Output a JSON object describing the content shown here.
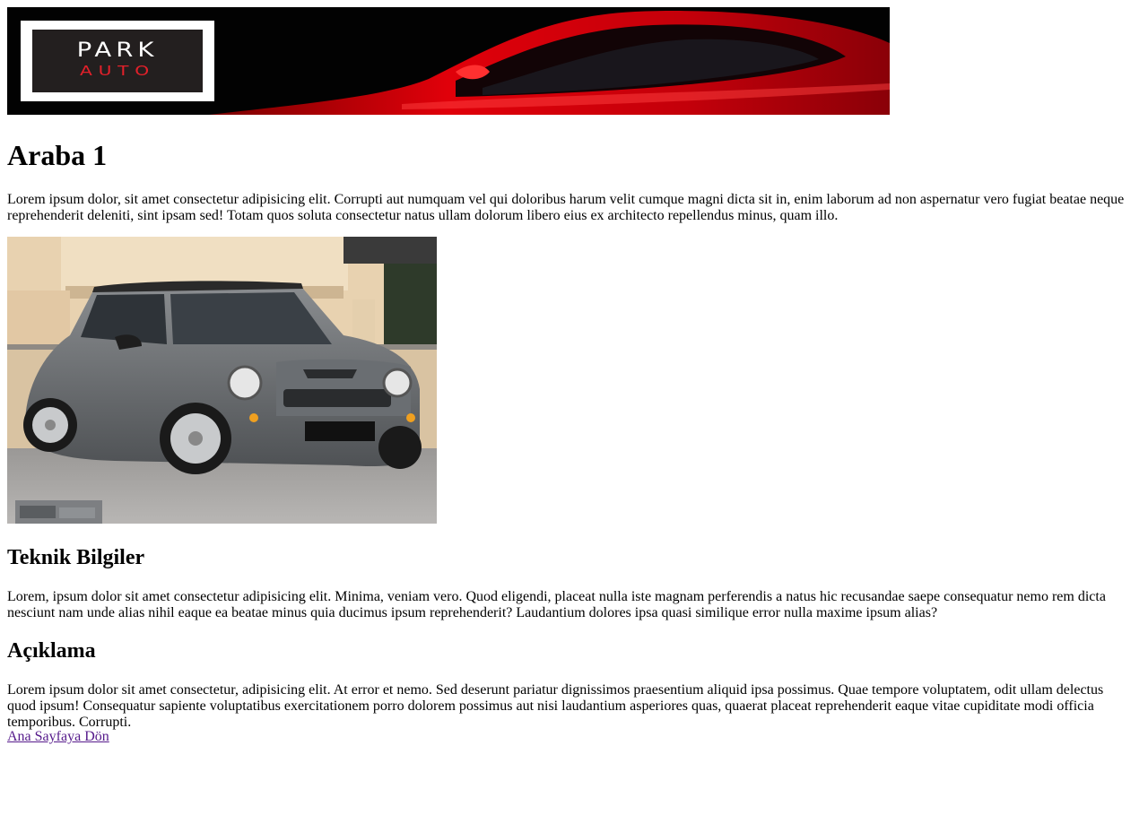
{
  "header": {
    "logo_top": "PARK",
    "logo_bottom": "AUTO",
    "brand_red": "#e2202a"
  },
  "title": "Araba 1",
  "intro": "Lorem ipsum dolor, sit amet consectetur adipisicing elit. Corrupti aut numquam vel qui doloribus harum velit cumque magni dicta sit in, enim laborum ad non aspernatur vero fugiat beatae neque reprehenderit deleniti, sint ipsam sed! Totam quos soluta consectetur natus ullam dolorum libero eius ex architecto repellendus minus, quam illo.",
  "photo": {
    "icon": "car-photo"
  },
  "sections": [
    {
      "heading": "Teknik Bilgiler",
      "body": "Lorem, ipsum dolor sit amet consectetur adipisicing elit. Minima, veniam vero. Quod eligendi, placeat nulla iste magnam perferendis a natus hic recusandae saepe consequatur nemo rem dicta nesciunt nam unde alias nihil eaque ea beatae minus quia ducimus ipsum reprehenderit? Laudantium dolores ipsa quasi similique error nulla maxime ipsum alias?"
    },
    {
      "heading": "Açıklama",
      "body": "Lorem ipsum dolor sit amet consectetur, adipisicing elit. At error et nemo. Sed deserunt pariatur dignissimos praesentium aliquid ipsa possimus. Quae tempore voluptatem, odit ullam delectus quod ipsum! Consequatur sapiente voluptatibus exercitationem porro dolorem possimus aut nisi laudantium asperiores quas, quaerat placeat reprehenderit eaque vitae cupiditate modi officia temporibus. Corrupti."
    }
  ],
  "back_link": "Ana Sayfaya Dön"
}
